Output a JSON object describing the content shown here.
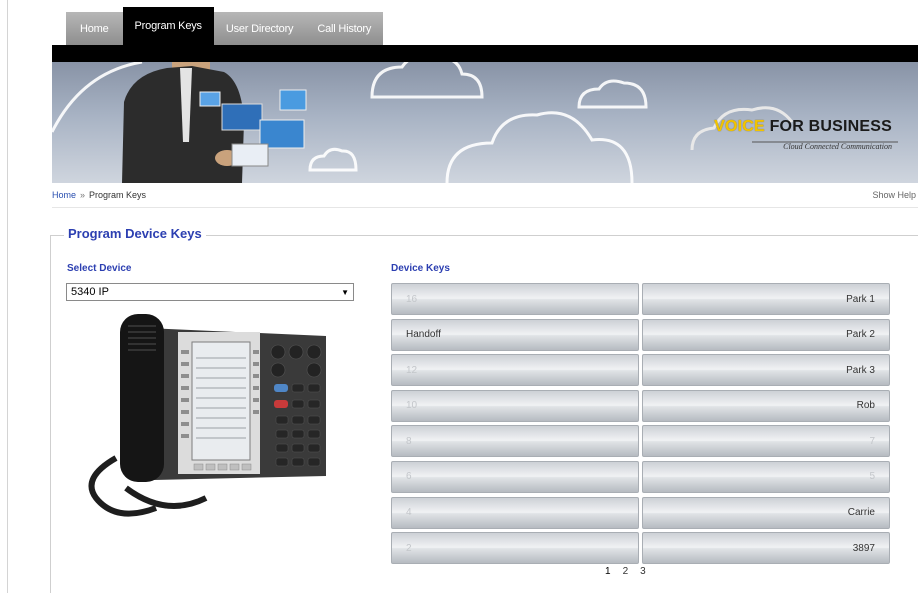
{
  "tabs": [
    {
      "label": "Home",
      "active": false
    },
    {
      "label": "Program Keys",
      "active": true
    },
    {
      "label": "User Directory",
      "active": false
    },
    {
      "label": "Call History",
      "active": false
    }
  ],
  "brand": {
    "highlight": "VOICE",
    "rest": " FOR BUSINESS",
    "tagline": "Cloud Connected Communication",
    "highlight_color": "#f2c400"
  },
  "breadcrumb": {
    "home": "Home",
    "separator": "»",
    "current": "Program Keys"
  },
  "show_help": "Show Help",
  "page_title": "Program Device Keys",
  "select_device": {
    "label": "Select Device",
    "value": "5340 IP"
  },
  "device_keys": {
    "label": "Device Keys",
    "rows": [
      {
        "left": "16",
        "right": "Park 1",
        "left_filled": false,
        "right_filled": true
      },
      {
        "left": "Handoff",
        "right": "Park 2",
        "left_filled": true,
        "right_filled": true
      },
      {
        "left": "12",
        "right": "Park 3",
        "left_filled": false,
        "right_filled": true
      },
      {
        "left": "10",
        "right": "Rob",
        "left_filled": false,
        "right_filled": true
      },
      {
        "left": "8",
        "right": "7",
        "left_filled": false,
        "right_filled": false
      },
      {
        "left": "6",
        "right": "5",
        "left_filled": false,
        "right_filled": false
      },
      {
        "left": "4",
        "right": "Carrie",
        "left_filled": false,
        "right_filled": true
      },
      {
        "left": "2",
        "right": "3897",
        "left_filled": false,
        "right_filled": true
      }
    ]
  },
  "pagination": {
    "pages": [
      "1",
      "2",
      "3"
    ],
    "current": "1"
  },
  "colors": {
    "accent_blue": "#2c3fb1",
    "tab_active": "#000000",
    "tab_inactive": "#a3a3a3"
  }
}
